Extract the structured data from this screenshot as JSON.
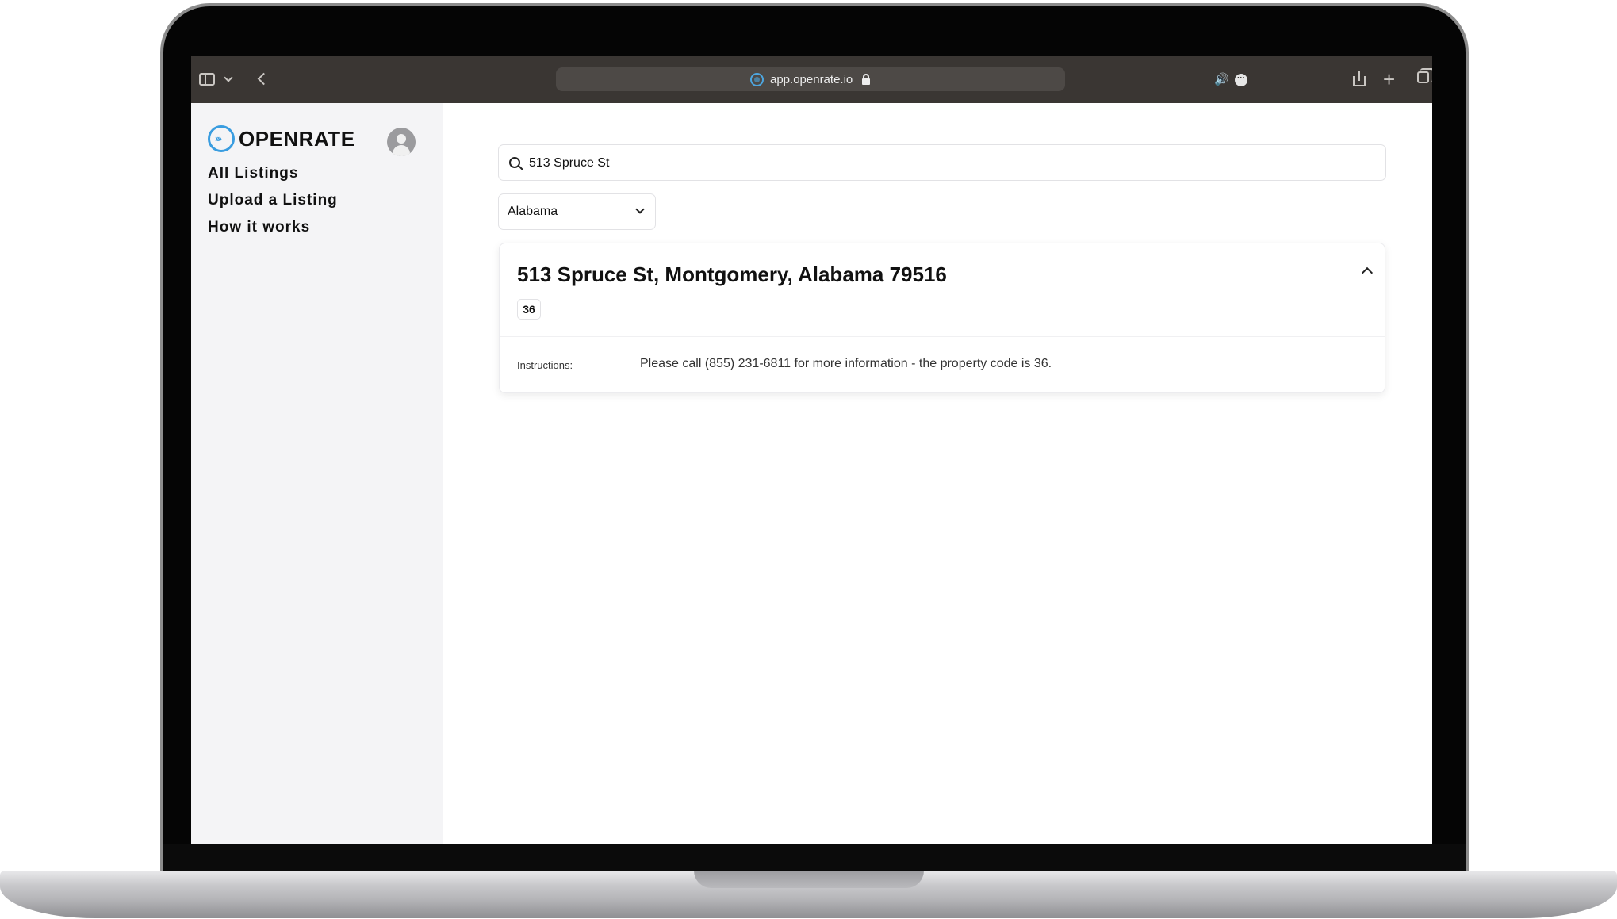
{
  "browser": {
    "url": "app.openrate.io",
    "icons": {
      "sidebar_toggle": "sidebar-toggle-icon",
      "tab_menu": "chevron-down-icon",
      "back": "chevron-left-icon",
      "lock": "lock-icon",
      "audio": "speaker-icon",
      "more": "ellipsis-icon",
      "share": "share-icon",
      "new_tab": "plus-icon",
      "tabs_overview": "tabs-icon"
    }
  },
  "sidebar": {
    "logo_text": "OPENRATE",
    "logo_mark": "›››",
    "avatar_icon": "user-avatar-icon",
    "nav": [
      {
        "label": "All Listings"
      },
      {
        "label": "Upload a Listing"
      },
      {
        "label": "How it works"
      }
    ]
  },
  "main": {
    "search": {
      "value": "513 Spruce St"
    },
    "state_filter": {
      "selected": "Alabama"
    },
    "listing": {
      "title": "513 Spruce St, Montgomery, Alabama 79516",
      "code": "36",
      "instructions_label": "Instructions:",
      "instructions_text": "Please call (855) 231-6811 for more information - the property code is 36.",
      "expanded": true
    }
  },
  "colors": {
    "toolbar_bg": "#3a3633",
    "sidebar_bg": "#f4f4f6",
    "brand_blue": "#3a9de0",
    "text_primary": "#111111"
  }
}
